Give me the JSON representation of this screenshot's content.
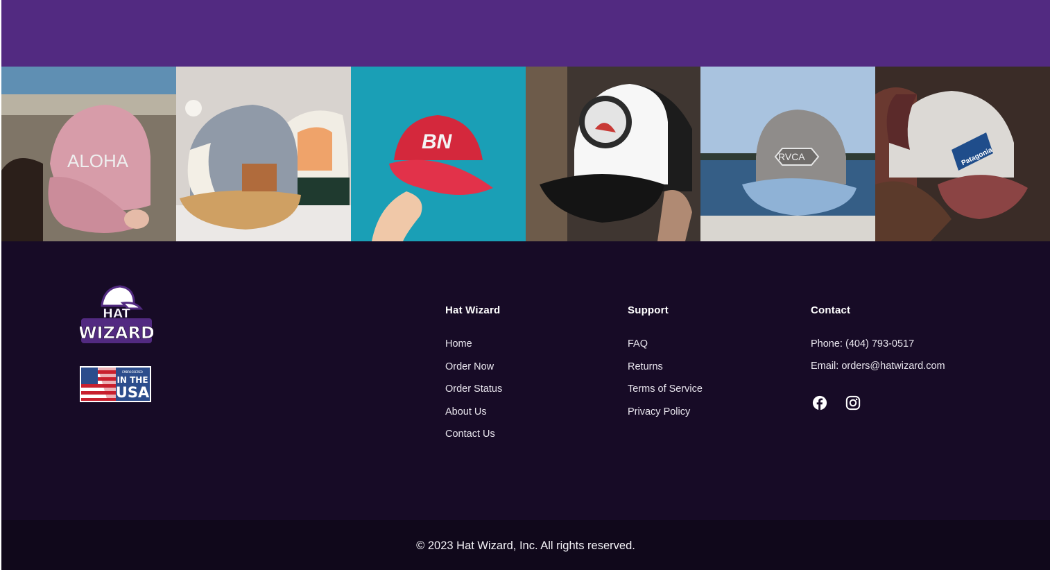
{
  "colors": {
    "top_band": "#522a81",
    "footer_bg": "#170b26",
    "bottom_bar_bg": "#10081b"
  },
  "gallery": {
    "photos": [
      {
        "hat_text": "ALOHA",
        "description_icon": "pink-hat-photo"
      },
      {
        "hat_text": "",
        "description_icon": "leather-patch-hat-photo"
      },
      {
        "hat_text": "BN",
        "description_icon": "red-hat-photo"
      },
      {
        "hat_text": "",
        "description_icon": "trucker-hat-photo"
      },
      {
        "hat_text": "RVCA",
        "description_icon": "rvca-hat-photo"
      },
      {
        "hat_text": "Patagonia",
        "description_icon": "patagonia-hat-photo"
      }
    ]
  },
  "brand": {
    "logo_line1": "HAT",
    "logo_line2": "WIZARD",
    "badge_small": "EMBROIDERED",
    "badge_line1": "IN THE",
    "badge_line2": "USA"
  },
  "footer": {
    "columns": [
      {
        "title": "Hat Wizard",
        "links": [
          "Home",
          "Order Now",
          "Order Status",
          "About Us",
          "Contact Us"
        ]
      },
      {
        "title": "Support",
        "links": [
          "FAQ",
          "Returns",
          "Terms of Service",
          "Privacy Policy"
        ]
      }
    ],
    "contact": {
      "title": "Contact",
      "phone": "Phone: (404) 793-0517",
      "email": "Email: orders@hatwizard.com",
      "social_icons": [
        "facebook-icon",
        "instagram-icon"
      ]
    }
  },
  "copyright": "© 2023 Hat Wizard, Inc. All rights reserved."
}
